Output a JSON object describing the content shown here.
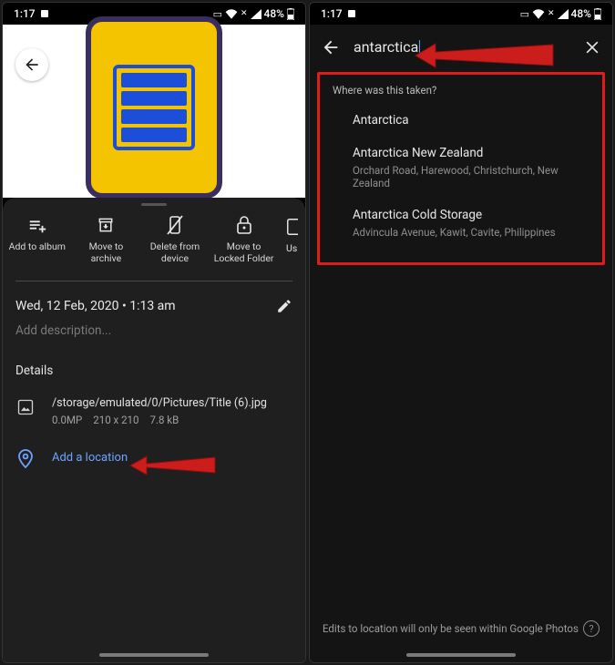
{
  "status": {
    "time": "1:17",
    "battery_pct": "48%"
  },
  "left": {
    "actions": {
      "add_album": "Add to album",
      "archive": "Move to archive",
      "delete": "Delete from device",
      "locked": "Move to Locked Folder",
      "truncated": "Us"
    },
    "datetime": "Wed, 12 Feb, 2020  •  1:13 am",
    "desc_placeholder": "Add description...",
    "details_header": "Details",
    "file": {
      "path": "/storage/emulated/0/Pictures/Title (6).jpg",
      "mp": "0.0MP",
      "dims": "210 x 210",
      "size": "7.8 kB"
    },
    "add_location": "Add a location"
  },
  "right": {
    "search_value": "antarctica",
    "prompt": "Where was this taken?",
    "suggestions": [
      {
        "title": "Antarctica",
        "sub": ""
      },
      {
        "title": "Antarctica New Zealand",
        "sub": "Orchard Road, Harewood, Christchurch, New Zealand"
      },
      {
        "title": "Antarctica Cold Storage",
        "sub": "Advincula Avenue, Kawit, Cavite, Philippines"
      }
    ],
    "footer": "Edits to location will only be seen within Google Photos"
  }
}
